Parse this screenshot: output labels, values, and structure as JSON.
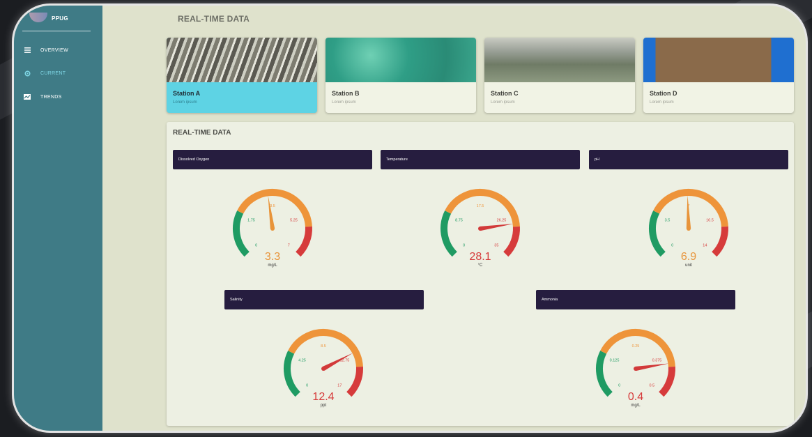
{
  "app": {
    "brand": "PPUG"
  },
  "sidebar": {
    "items": [
      {
        "label": "OVERVIEW",
        "icon": "menu-icon",
        "active": false
      },
      {
        "label": "CURRENT",
        "icon": "gear-icon",
        "active": true
      },
      {
        "label": "TRENDS",
        "icon": "chart-icon",
        "active": false
      }
    ]
  },
  "header": {
    "title": "REAL-TIME DATA"
  },
  "stations": [
    {
      "name": "Station A",
      "subtitle": "Lorem ipsum",
      "active": true
    },
    {
      "name": "Station B",
      "subtitle": "Lorem ipsum",
      "active": false
    },
    {
      "name": "Station C",
      "subtitle": "Lorem ipsum",
      "active": false
    },
    {
      "name": "Station D",
      "subtitle": "Lorem ipsum",
      "active": false
    }
  ],
  "panel": {
    "title": "REAL-TIME DATA",
    "gauges": [
      {
        "label": "Dissolved Oxygen",
        "value": "3.3",
        "unit": "mg/L",
        "min": 0,
        "max": 7,
        "reading": 3.3,
        "ticks": [
          "0",
          "1.75",
          "3.5",
          "5.25",
          "7"
        ],
        "value_color": "#e8943a"
      },
      {
        "label": "Temperature",
        "value": "28.1",
        "unit": "°C",
        "min": 0,
        "max": 35,
        "reading": 28.1,
        "ticks": [
          "0",
          "8.75",
          "17.5",
          "26.25",
          "35"
        ],
        "value_color": "#d63a3a"
      },
      {
        "label": "pH",
        "value": "6.9",
        "unit": "unit",
        "min": 0,
        "max": 14,
        "reading": 6.9,
        "ticks": [
          "0",
          "3.5",
          "7",
          "10.5",
          "14"
        ],
        "value_color": "#e8943a"
      },
      {
        "label": "Salinity",
        "value": "12.4",
        "unit": "ppt",
        "min": 0,
        "max": 17,
        "reading": 12.4,
        "ticks": [
          "0",
          "4.25",
          "8.5",
          "12.75",
          "17"
        ],
        "value_color": "#d63a3a"
      },
      {
        "label": "Ammonia",
        "value": "0.4",
        "unit": "mg/L",
        "min": 0,
        "max": 0.5,
        "reading": 0.4,
        "ticks": [
          "0",
          "0.125",
          "0.25",
          "0.375",
          "0.5"
        ],
        "value_color": "#d63a3a"
      }
    ]
  },
  "colors": {
    "green": "#1f9b63",
    "orange": "#ee943a",
    "red": "#d63b3b",
    "needle_orange": "#e8943a",
    "needle_red": "#d23a3a"
  }
}
